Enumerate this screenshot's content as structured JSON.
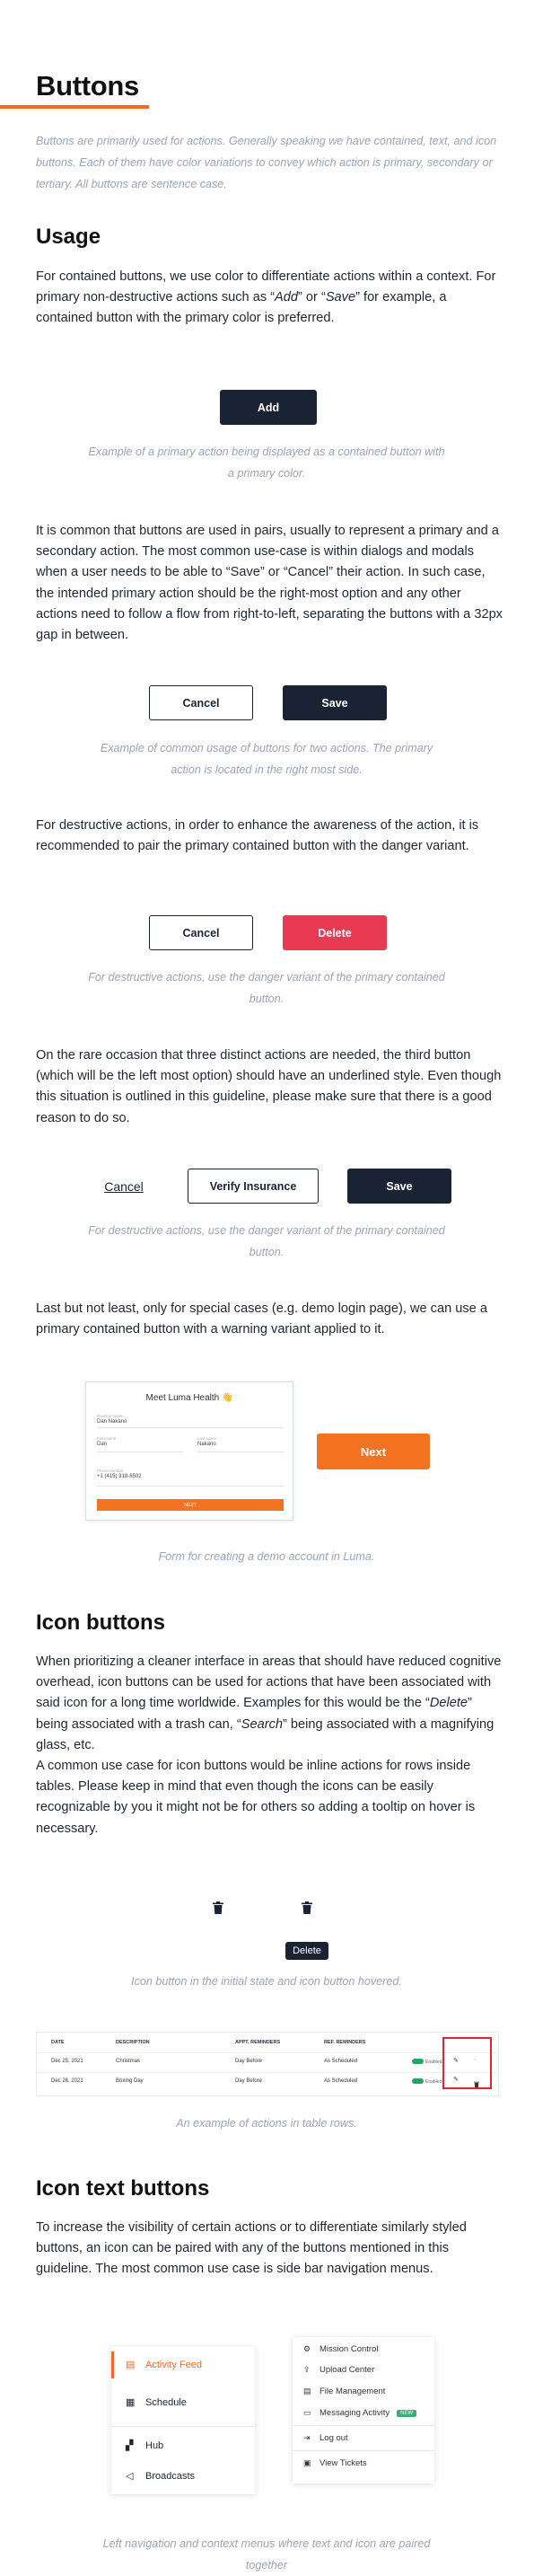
{
  "page": {
    "title": "Buttons",
    "intro": "Buttons are primarily used for actions. Generally speaking we have contained, text, and icon buttons. Each of them have color variations to convey which action is primary, secondary or tertiary. All buttons are sentence case."
  },
  "usage": {
    "heading": "Usage",
    "p1_a": "For contained buttons, we use color to differentiate actions within a context. For primary non-destructive actions such as “",
    "p1_add": "Add",
    "p1_b": "” or “",
    "p1_save": "Save",
    "p1_c": "” for example, a contained button with the primary color is preferred.",
    "add_button": "Add",
    "caption1": "Example of a primary action being displayed as a contained button with a primary color.",
    "p2": "It is common that buttons are used in pairs, usually to represent a primary and a secondary action. The most common use-case is within dialogs and modals when a user needs to be able to “Save” or “Cancel” their action. In such case, the intended primary action should be the right-most option and any other actions need to follow a flow from right-to-left, separating the buttons with a 32px gap in between.",
    "cancel_button": "Cancel",
    "save_button": "Save",
    "caption2": "Example of common usage of buttons for two actions. The primary action is located in the right most side.",
    "p3": "For destructive actions, in order to enhance the awareness of the action, it is recommended to pair the primary contained button with the danger variant.",
    "cancel_button2": "Cancel",
    "delete_button": "Delete",
    "caption3": "For destructive actions, use the danger variant of the primary contained button.",
    "p4": "On the rare occasion that three distinct actions are needed, the third button (which will be the left most option) should have an underlined style. Even though this situation is outlined in this guideline, please make sure that there is a good reason to do so.",
    "text_cancel": "Cancel",
    "verify_button": "Verify Insurance",
    "save_button2": "Save",
    "caption4": "For destructive actions, use the danger variant of the primary contained button.",
    "p5": "Last but not least, only for special cases (e.g. demo login page), we can use a primary contained button with a warning variant applied to it.",
    "next_button": "Next",
    "caption5": "Form for creating a demo account in Luma."
  },
  "demo_card": {
    "title": "Meet Luma Health 👋",
    "practice_label": "Practice name",
    "practice_value": "Dan Nakano",
    "first_label": "First name",
    "first_value": "Dan",
    "last_label": "Last name",
    "last_value": "Nakano",
    "phone_label": "Phone number",
    "phone_value": "+1 (415) 318-8502",
    "button": "NEXT"
  },
  "icon_buttons": {
    "heading": "Icon buttons",
    "p1_a": "When prioritizing a cleaner interface in areas that should have reduced cognitive overhead, icon buttons can be used for actions that have been associated with said icon for a long time worldwide. Examples for this would be the “",
    "p1_delete": "Delete",
    "p1_b": "” being associated with a trash can, “",
    "p1_search": "Search",
    "p1_c": "” being associated with a magnifying glass, etc.",
    "p2": "A common use case for icon buttons would be inline actions for rows inside tables. Please keep in mind that even though the icons can be easily recognizable by you it might not be for others so adding a tooltip on hover is necessary.",
    "tooltip": "Delete",
    "caption1": "Icon button in the initial state and icon button hovered.",
    "caption2": "An example of actions in table rows."
  },
  "table": {
    "headers": [
      "DATE",
      "DESCRIPTION",
      "APPT. REMINDERS",
      "REF. REMINDERS"
    ],
    "rows": [
      {
        "date": "Dec 25, 2021",
        "desc": "Christmas",
        "appt": "Day Before",
        "ref": "As Scheduled",
        "toggle": "Enabled"
      },
      {
        "date": "Dec 26, 2021",
        "desc": "Boxing Day",
        "appt": "Day Before",
        "ref": "As Scheduled",
        "toggle": "Enabled"
      }
    ]
  },
  "icon_text": {
    "heading": "Icon text buttons",
    "p1": "To increase the visibility of certain actions or to differentiate similarly styled buttons, an icon can be paired with any of the buttons mentioned in this guideline. The most common use case is side bar navigation menus.",
    "caption": "Left navigation and context menus where text and icon are paired together"
  },
  "left_nav": {
    "items": [
      "Activity Feed",
      "Schedule",
      "Hub",
      "Broadcasts"
    ]
  },
  "context_menu": {
    "items": [
      "Mission Control",
      "Upload Center",
      "File Management",
      "Messaging Activity",
      "Log out",
      "View Tickets"
    ],
    "new_badge": "NEW"
  },
  "colors": {
    "accent": "#f26a21",
    "primary": "#1a2333",
    "danger": "#e83a52",
    "warning": "#f47321",
    "caption": "#9aa3b8"
  }
}
